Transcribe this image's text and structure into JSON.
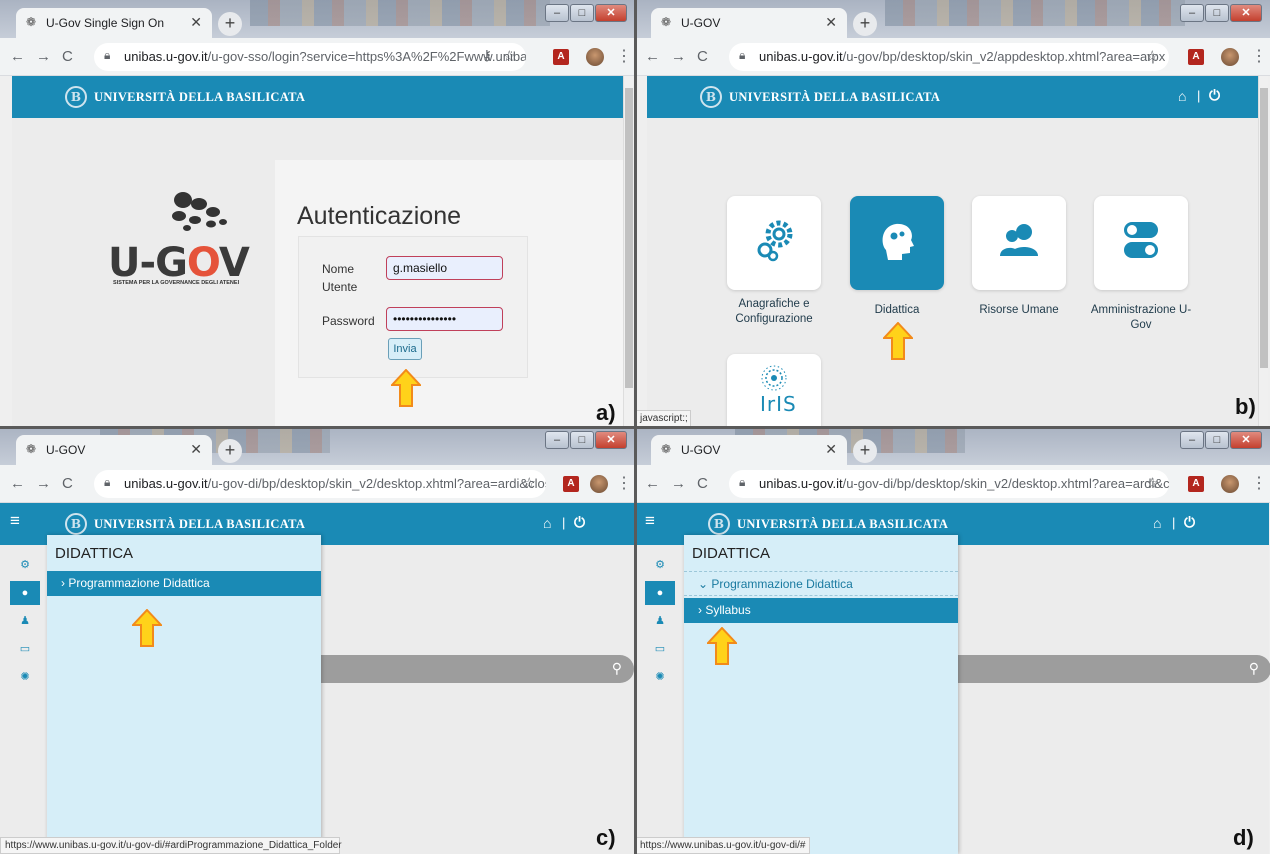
{
  "panels": {
    "a": {
      "tab_title": "U-Gov Single Sign On",
      "url_host": "unibas.u-gov.it",
      "url_path": "/u-gov-sso/login?service=https%3A%2F%2Fwww.unibas....",
      "site_name": "UNIVERSITÀ DELLA BASILICATA",
      "brand_name": "U-GOV",
      "brand_subtitle": "SISTEMA PER LA GOVERNANCE DEGLI ATENEI",
      "auth_title": "Autenticazione",
      "username_label": "Nome Utente",
      "username_value": "g.masiello",
      "password_label": "Password",
      "password_value": "•••••••••••••••",
      "submit_label": "Invia",
      "panel_label": "a)"
    },
    "b": {
      "tab_title": "U-GOV",
      "url_host": "unibas.u-gov.it",
      "url_path": "/u-gov/bp/desktop/skin_v2/appdesktop.xhtml?area=arpx",
      "site_name": "UNIVERSITÀ DELLA BASILICATA",
      "tiles": [
        {
          "label": "Anagrafiche e Configurazione",
          "icon": "gears-icon"
        },
        {
          "label": "Didattica",
          "icon": "head-icon"
        },
        {
          "label": "Risorse Umane",
          "icon": "users-icon"
        },
        {
          "label": "Amministrazione U-Gov",
          "icon": "toggles-icon"
        },
        {
          "label": "",
          "icon": "iris-logo"
        }
      ],
      "iris_text": "IrIS",
      "status_text": "javascript:;",
      "panel_label": "b)"
    },
    "c": {
      "tab_title": "U-GOV",
      "url_host": "unibas.u-gov.it",
      "url_path": "/u-gov-di/bp/desktop/skin_v2/desktop.xhtml?area=ardi&close...",
      "site_name": "UNIVERSITÀ DELLA BASILICATA",
      "menu_title": "DIDATTICA",
      "menu_item": "› Programmazione Didattica",
      "status_text": "https://www.unibas.u-gov.it/u-gov-di/#ardiProgrammazione_Didattica_Folder",
      "panel_label": "c)"
    },
    "d": {
      "tab_title": "U-GOV",
      "url_host": "unibas.u-gov.it",
      "url_path": "/u-gov-di/bp/desktop/skin_v2/desktop.xhtml?area=ardi&close...",
      "site_name": "UNIVERSITÀ DELLA BASILICATA",
      "menu_title": "DIDATTICA",
      "menu_item_parent": "⌄ Programmazione Didattica",
      "menu_item_child": "› Syllabus",
      "status_text": "https://www.unibas.u-gov.it/u-gov-di/#",
      "panel_label": "d)"
    }
  },
  "colors": {
    "brand_blue": "#1a8ab5",
    "menu_bg": "#d6eef8",
    "arrow_fill": "#ffd21a",
    "arrow_stroke": "#f28a1a"
  }
}
